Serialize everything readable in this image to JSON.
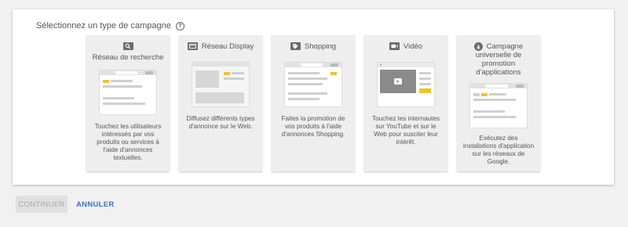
{
  "heading": {
    "label": "Sélectionnez un type de campagne",
    "help_icon": "?"
  },
  "cards": [
    {
      "icon": "search-icon",
      "title": "Réseau de recherche",
      "description": "Touchez les utilisateurs intéressés par vos produits ou services à l'aide d'annonces textuelles."
    },
    {
      "icon": "display-icon",
      "title": "Réseau Display",
      "description": "Diffusez différents types d'annonce sur le Web."
    },
    {
      "icon": "shopping-tag-icon",
      "title": "Shopping",
      "description": "Faites la promotion de vos produits à l'aide d'annonces Shopping."
    },
    {
      "icon": "video-camera-icon",
      "title": "Vidéo",
      "description": "Touchez les internautes sur YouTube et sur le Web pour susciter leur intérêt."
    },
    {
      "icon": "app-download-icon",
      "title_lines": [
        "Campagne",
        "universelle de",
        "promotion",
        "d'applications"
      ],
      "description": "Exécutez des installations d'application sur les réseaux de Google."
    }
  ],
  "actions": {
    "continue_label": "CONTINUER",
    "cancel_label": "ANNULER"
  },
  "colors": {
    "accent": "#3f72c7",
    "highlight": "#f2c230"
  }
}
